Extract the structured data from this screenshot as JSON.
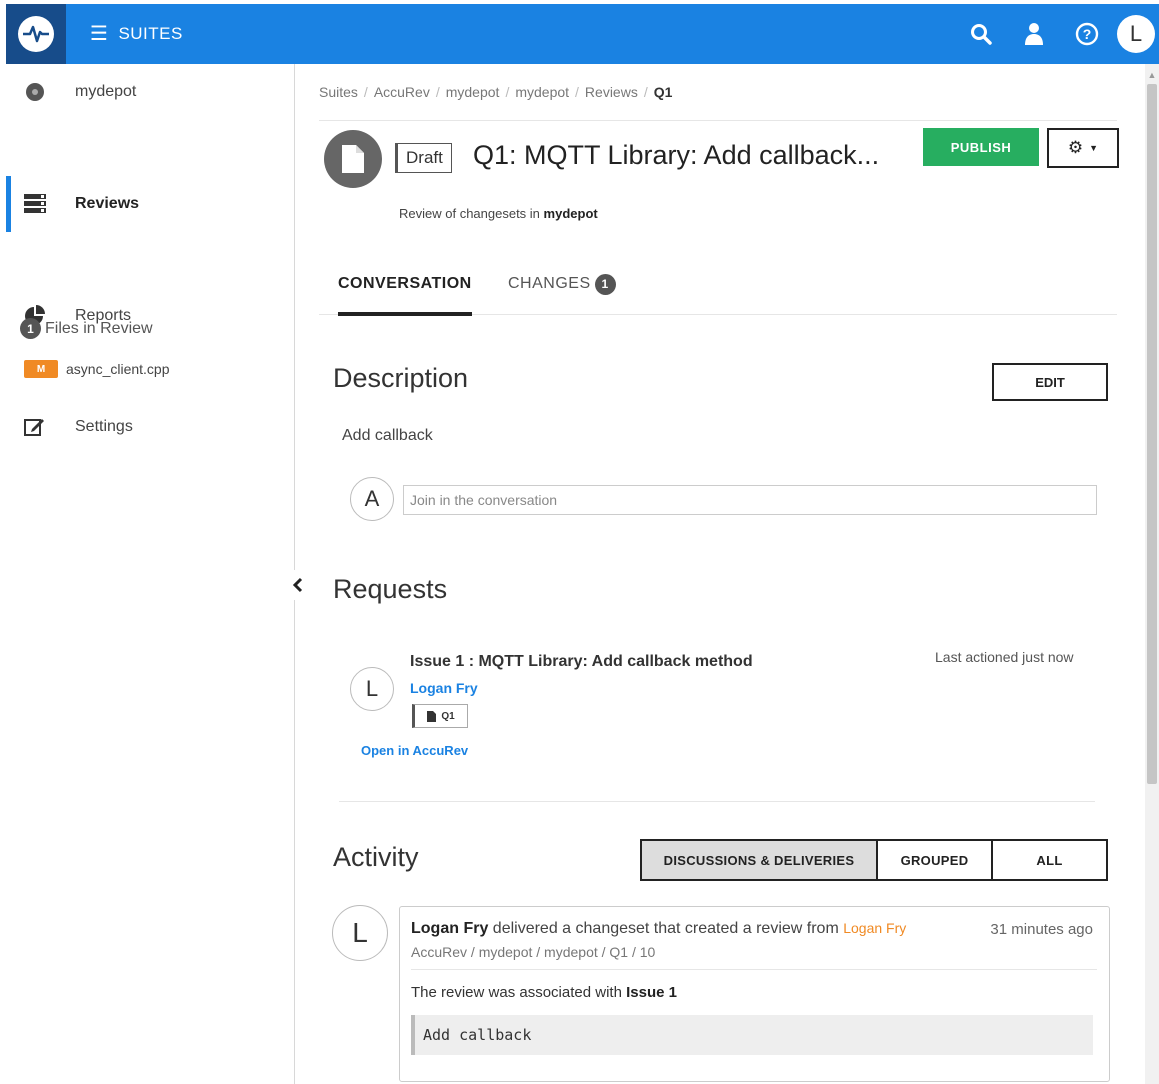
{
  "topbar": {
    "suites_label": "SUITES",
    "avatar_initial": "L",
    "brand_color": "#1a82e2"
  },
  "sidebar": {
    "items": [
      {
        "label": "mydepot",
        "icon": "depot-icon"
      },
      {
        "label": "Reviews",
        "icon": "reviews-icon",
        "active": true
      },
      {
        "label": "Reports",
        "icon": "pie-chart-icon"
      },
      {
        "label": "Settings",
        "icon": "edit-icon"
      }
    ],
    "files_count": "1",
    "files_label": "Files in Review",
    "files": [
      {
        "status": "M",
        "name": "async_client.cpp"
      }
    ]
  },
  "breadcrumb": [
    "Suites",
    "AccuRev",
    "mydepot",
    "mydepot",
    "Reviews",
    "Q1"
  ],
  "review": {
    "status": "Draft",
    "title": "Q1: MQTT Library: Add callback...",
    "publish_label": "PUBLISH",
    "subtitle_prefix": "Review of changesets in",
    "subtitle_depot": "mydepot"
  },
  "tabs": [
    {
      "label": "CONVERSATION",
      "active": true
    },
    {
      "label": "CHANGES",
      "count": "1"
    }
  ],
  "description": {
    "heading": "Description",
    "edit_label": "EDIT",
    "text": "Add callback",
    "comment_avatar": "A",
    "comment_placeholder": "Join in the conversation"
  },
  "requests": {
    "heading": "Requests",
    "issue_title": "Issue 1 : MQTT Library: Add callback method",
    "author": "Logan Fry",
    "avatar": "L",
    "chip": "Q1",
    "last_actioned": "Last actioned just now",
    "open_link": "Open in AccuRev"
  },
  "activity": {
    "heading": "Activity",
    "filters": [
      {
        "label": "DISCUSSIONS & DELIVERIES",
        "active": true
      },
      {
        "label": "GROUPED"
      },
      {
        "label": "ALL"
      }
    ],
    "items": [
      {
        "avatar": "L",
        "author": "Logan Fry",
        "action": "delivered a changeset that created a review from",
        "from": "Logan Fry",
        "time": "31 minutes ago",
        "path": "AccuRev / mydepot / mydepot / Q1 / 10",
        "note_prefix": "The review was associated with",
        "note_target": "Issue 1",
        "code": "Add callback"
      }
    ]
  },
  "colors": {
    "accent": "#1a82e2",
    "publish": "#27ae60",
    "modified_badge": "#f08a24"
  }
}
